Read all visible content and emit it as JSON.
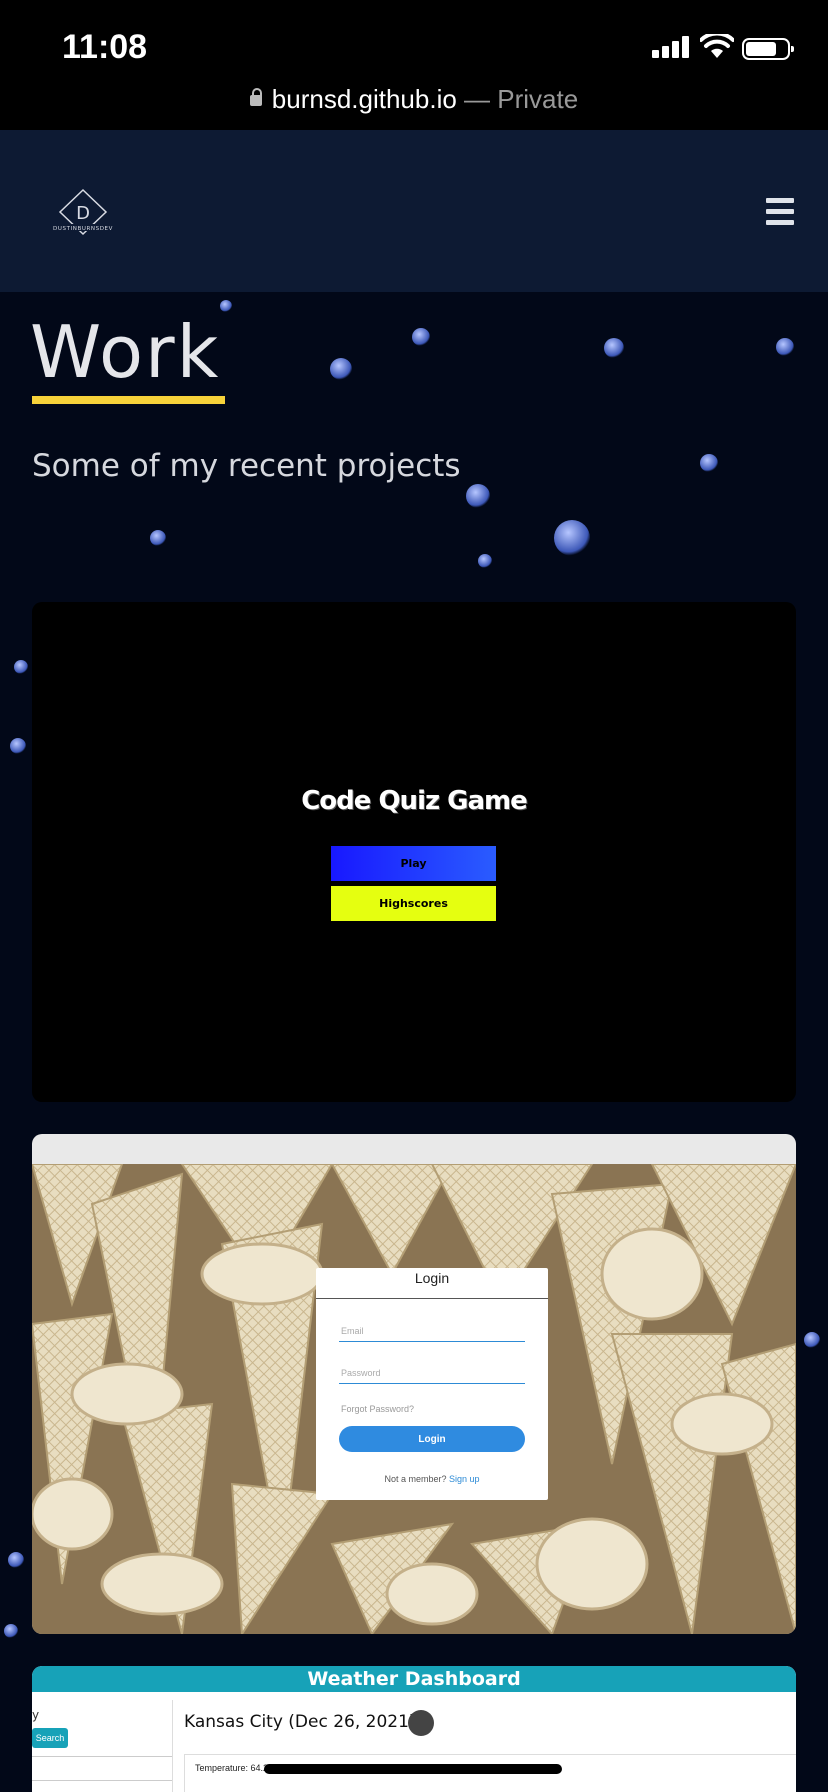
{
  "status_bar": {
    "time": "11:08",
    "url": "burnsd.github.io",
    "privacy": "— Private"
  },
  "nav": {
    "logo_letter": "D",
    "logo_text": "DUSTINBURNSDEV",
    "menu_icon": "hamburger-icon"
  },
  "hero": {
    "title": "Work",
    "subtitle": "Some of my recent projects",
    "accent_color": "#f7d23a"
  },
  "projects": {
    "quiz": {
      "title": "Code Quiz Game",
      "play_label": "Play",
      "highscores_label": "Highscores"
    },
    "login": {
      "title": "Login",
      "email_placeholder": "Email",
      "password_placeholder": "Password",
      "forgot": "Forgot Password?",
      "button": "Login",
      "not_member": "Not a member?",
      "signup": "Sign up"
    },
    "weather": {
      "title": "Weather Dashboard",
      "side_text": "y",
      "search_label": "Search",
      "city": "Kansas City (Dec 26, 2021)",
      "temperature": "Temperature: 64.2"
    }
  }
}
